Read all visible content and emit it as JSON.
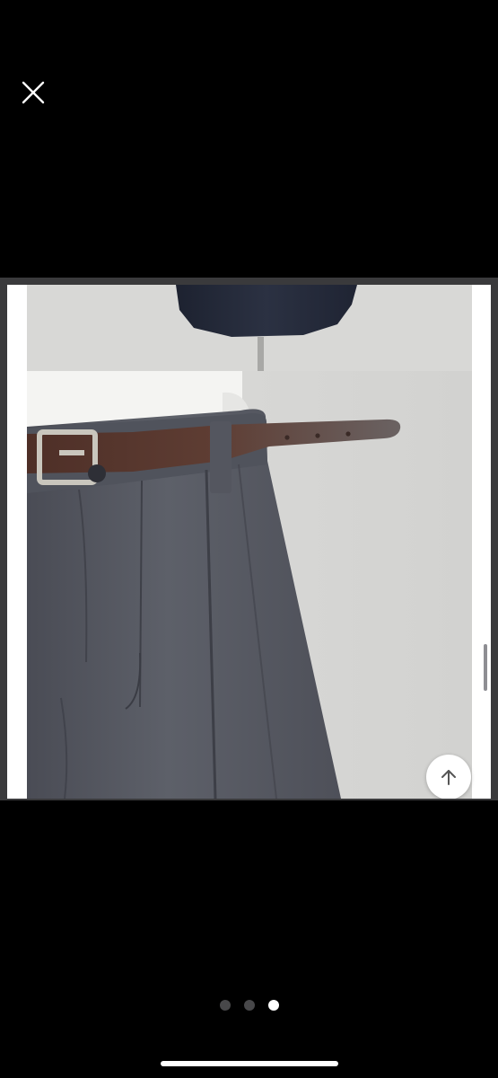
{
  "viewer": {
    "close_icon": "close-icon",
    "scroll_top_icon": "arrow-up-icon",
    "image_alt": "",
    "pager": {
      "total": 3,
      "current": 3
    },
    "colors": {
      "background": "#000000",
      "frame": "#3a3a3c",
      "dot_inactive": "#48484a",
      "dot_active": "#ffffff"
    }
  }
}
